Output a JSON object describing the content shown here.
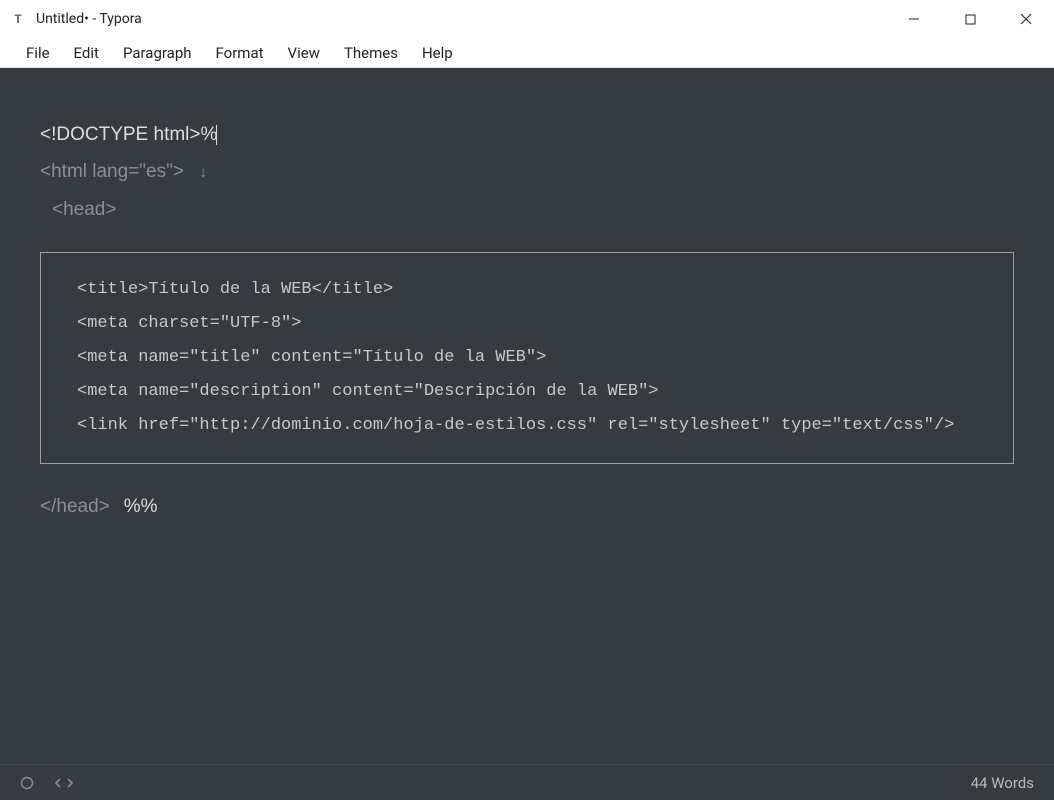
{
  "window": {
    "title": "Untitled• - Typora"
  },
  "menu": {
    "file": "File",
    "edit": "Edit",
    "paragraph": "Paragraph",
    "format": "Format",
    "view": "View",
    "themes": "Themes",
    "help": "Help"
  },
  "content": {
    "line1": "<!DOCTYPE html>%",
    "line2": "<html lang=\"es\">",
    "line3": "<head>",
    "code": {
      "l1": "<title>Título de la WEB</title>",
      "l2": "<meta charset=\"UTF-8\">",
      "l3": "<meta name=\"title\" content=\"Título de la WEB\">",
      "l4": "<meta name=\"description\" content=\"Descripción de la WEB\">",
      "l5": "<link href=\"http://dominio.com/hoja-de-estilos.css\" rel=\"stylesheet\" type=\"text/css\"/>"
    },
    "line4_tag": "</head>",
    "line4_pct": "%%"
  },
  "status": {
    "words": "44 Words"
  }
}
